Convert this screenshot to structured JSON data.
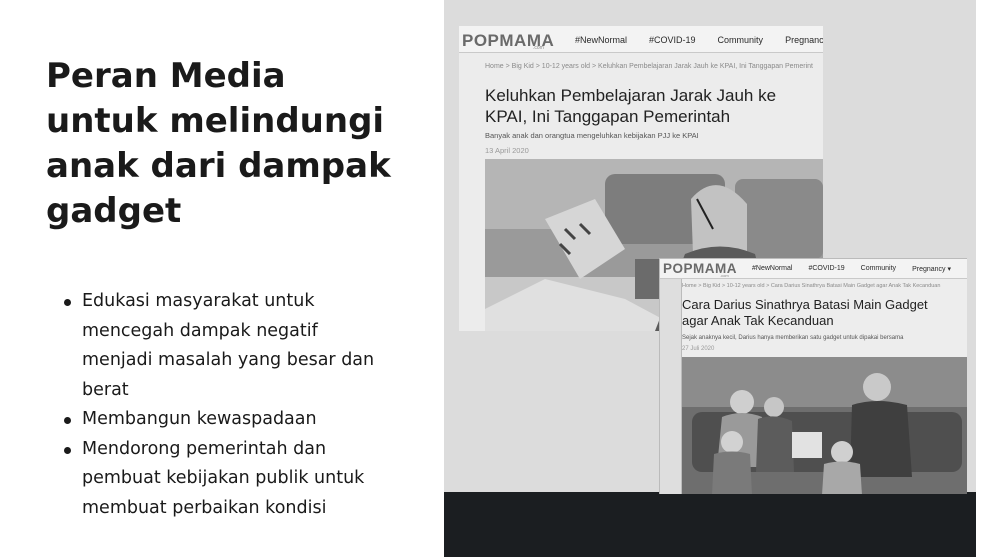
{
  "slide": {
    "title_lines": [
      "Peran Media",
      "untuk melindungi",
      "anak dari dampak",
      "gadget"
    ],
    "bullets": [
      {
        "lines": [
          "Edukasi masyarakat untuk",
          "mencegah dampak negatif",
          "menjadi masalah yang besar dan",
          "berat"
        ]
      },
      {
        "lines": [
          "Membangun kewaspadaan"
        ]
      },
      {
        "lines": [
          "Mendorong pemerintah dan",
          "pembuat kebijakan publik untuk",
          "membuat perbaikan kondisi"
        ]
      }
    ]
  },
  "article1": {
    "logo": "POPMAMA",
    "logo_sub": ".com",
    "nav": [
      "#NewNormal",
      "#COVID-19",
      "Community",
      "Pregnancy"
    ],
    "breadcrumb": "Home  >  Big Kid  >  10-12 years old  >  Keluhkan Pembelajaran Jarak Jauh ke KPAI, Ini Tanggapan Pemerint",
    "headline_lines": [
      "Keluhkan Pembelajaran Jarak Jauh ke",
      "KPAI, Ini Tanggapan Pemerintah"
    ],
    "subtitle": "Banyak anak dan orangtua mengeluhkan kebijakan PJJ ke KPAI",
    "date": "13 April 2020"
  },
  "article2": {
    "logo": "POPMAMA",
    "logo_sub": ".com",
    "nav": [
      "#NewNormal",
      "#COVID-19",
      "Community",
      "Pregnancy ▾"
    ],
    "breadcrumb": "Home  >  Big Kid  >  10-12 years old  >  Cara Darius Sinathrya Batasi Main Gadget agar Anak Tak Kecanduan",
    "headline_lines": [
      "Cara Darius Sinathrya Batasi Main Gadget",
      "agar Anak Tak Kecanduan"
    ],
    "subtitle": "Sejak anaknya kecil, Darius hanya memberikan satu gadget untuk dipakai bersama",
    "date": "27 Juli 2020"
  },
  "colors": {
    "panel_bg": "#dcdcdc",
    "panel_footer": "#1b1e21",
    "text": "#1a1a1a"
  }
}
